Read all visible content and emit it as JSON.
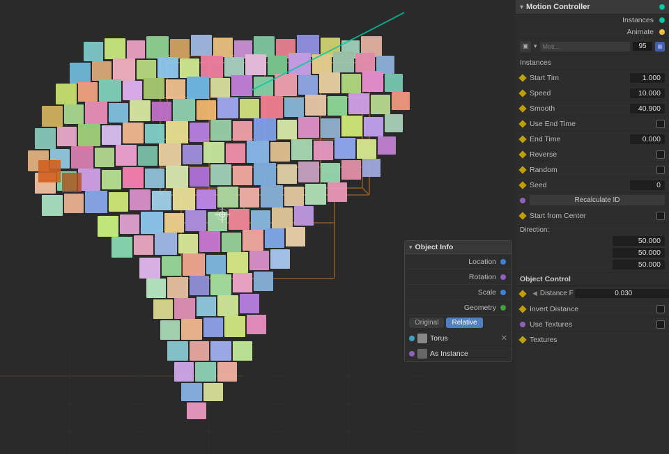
{
  "viewport": {
    "background": "#2a2a2a"
  },
  "motion_controller": {
    "title": "Motion Controller",
    "instances_dot_color": "#00c8a0",
    "animate_dot_color": "#f0c040",
    "moti_field": "Moti...",
    "moti_value": "95",
    "instances_label": "Instances",
    "animate_label": "Animate",
    "properties": [
      {
        "id": "start_time",
        "label": "Start Tim",
        "value": "1.000",
        "dot": "#c0a000",
        "type": "diamond"
      },
      {
        "id": "speed",
        "label": "Speed",
        "value": "10.000",
        "dot": "#c0a000",
        "type": "diamond"
      },
      {
        "id": "smooth",
        "label": "Smooth",
        "value": "40.900",
        "dot": "#c0a000",
        "type": "diamond"
      },
      {
        "id": "use_end_time",
        "label": "Use End Time",
        "dot": "#c0a000",
        "type": "diamond",
        "value": ""
      },
      {
        "id": "end_time",
        "label": "End Time",
        "value": "0.000",
        "dot": "#c0a000",
        "type": "diamond"
      },
      {
        "id": "reverse",
        "label": "Reverse",
        "dot": "#c0a000",
        "type": "diamond",
        "value": ""
      },
      {
        "id": "random",
        "label": "Random",
        "dot": "#c0a000",
        "type": "diamond",
        "value": ""
      },
      {
        "id": "seed",
        "label": "Seed",
        "value": "0",
        "dot": "#c0a000",
        "type": "diamond"
      }
    ],
    "recalculate_id": "Recalculate ID",
    "start_from_center": "Start from Center",
    "start_from_center_dot": "#9060c0",
    "direction_label": "Direction:",
    "direction_values": [
      "50.000",
      "50.000",
      "50.000"
    ],
    "object_control_label": "Object Control",
    "distance_label": "Distance F",
    "distance_value": "0.030",
    "invert_distance": "Invert Distance",
    "use_textures": "Use Textures",
    "textures_label": "Textures",
    "invert_dot": "#c0a000",
    "use_tex_dot": "#9060c0",
    "tex_dot": "#c0a000"
  },
  "object_info": {
    "title": "Object Info",
    "location_label": "Location",
    "rotation_label": "Rotation",
    "scale_label": "Scale",
    "geometry_label": "Geometry",
    "location_dot": "#4080d0",
    "rotation_dot": "#9060c0",
    "scale_dot": "#4080d0",
    "geometry_dot": "#40a040",
    "toggle_original": "Original",
    "toggle_relative": "Relative",
    "objects": [
      {
        "name": "Torus",
        "swatch": "#888"
      },
      {
        "name": "As Instance",
        "swatch": "#555"
      }
    ],
    "object_dot": "#40a0c0",
    "instance_dot": "#9060c0"
  },
  "panel": {
    "instances_section_label": "Instances"
  }
}
